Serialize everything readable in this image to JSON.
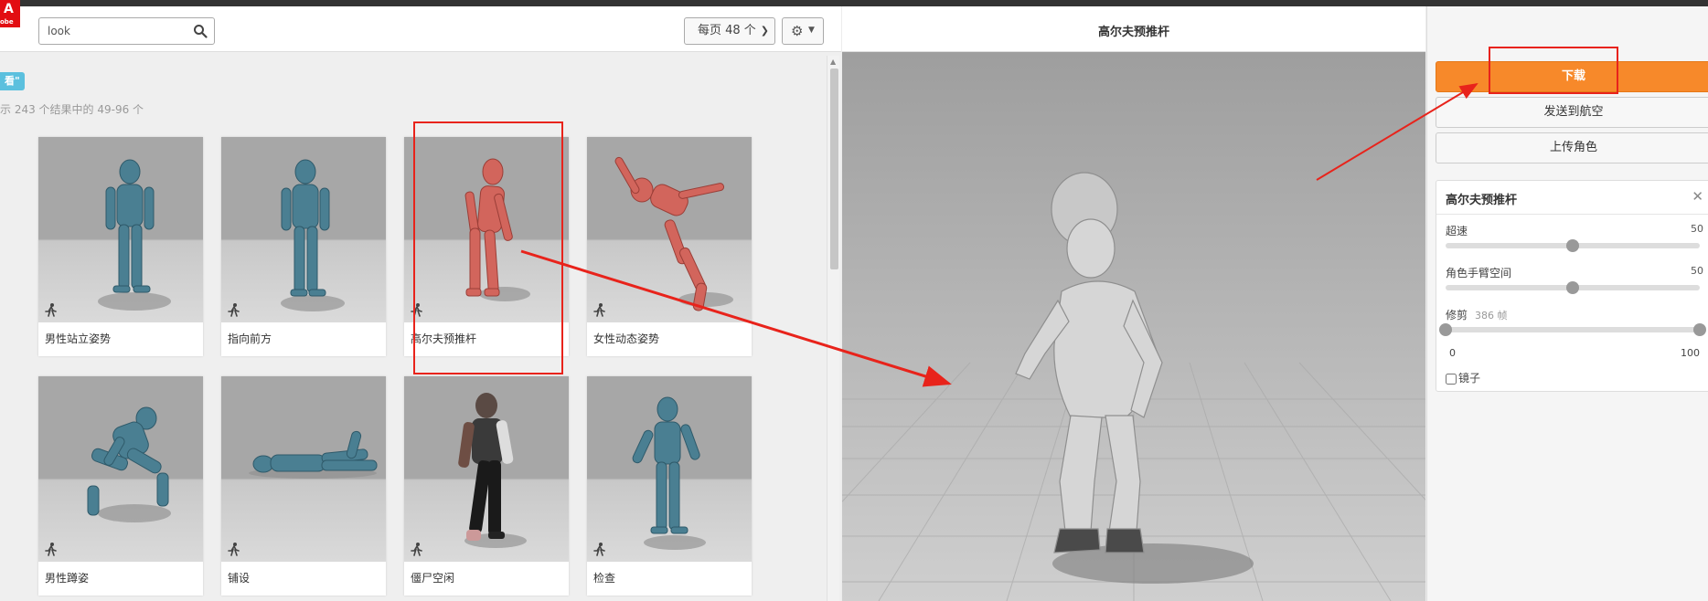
{
  "window": {
    "title": "高尔夫预推杆"
  },
  "logo": {
    "glyph": "A",
    "text": "obe"
  },
  "toolbar": {
    "search": {
      "value": "look",
      "placeholder": ""
    },
    "per_page": "每页 48 个",
    "search_icon": "magnifier-icon",
    "settings_icon": "gear-icon"
  },
  "results": {
    "tag": "看\"",
    "count_text": "示 243 个结果中的 49-96 个",
    "items": [
      {
        "label": "男性站立姿势",
        "icon": "running-man-icon"
      },
      {
        "label": "指向前方",
        "icon": "running-man-icon"
      },
      {
        "label": "高尔夫预推杆",
        "icon": "running-man-icon",
        "selected": true
      },
      {
        "label": "女性动态姿势",
        "icon": "running-man-icon"
      },
      {
        "label": "男性蹲姿",
        "icon": "running-man-icon"
      },
      {
        "label": "铺设",
        "icon": "running-man-icon"
      },
      {
        "label": "僵尸空闲",
        "icon": "running-man-icon"
      },
      {
        "label": "检查",
        "icon": "running-man-icon"
      }
    ]
  },
  "viewer": {
    "title": "高尔夫预推杆"
  },
  "sidebar": {
    "download_label": "下载",
    "send_label": "发送到航空",
    "upload_label": "上传角色",
    "settings": {
      "title": "高尔夫预推杆",
      "overdrive": {
        "label": "超速",
        "value": "50",
        "fraction": 0.5
      },
      "arm_space": {
        "label": "角色手臂空间",
        "value": "50",
        "fraction": 0.5
      },
      "trim": {
        "label": "修剪",
        "frames": "386 帧",
        "min": "0",
        "max": "100",
        "start_fraction": 0.0,
        "end_fraction": 1.0
      },
      "mirror": {
        "label": "镜子",
        "checked": false
      }
    }
  },
  "annotation_color": "#e8231b",
  "accent_color": "#f7892a"
}
